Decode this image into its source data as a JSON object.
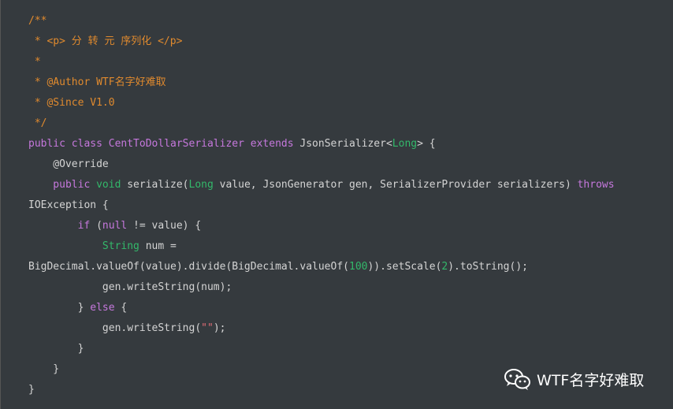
{
  "code": {
    "lines": [
      [
        {
          "t": "/**",
          "c": "cm"
        }
      ],
      [
        {
          "t": " * <p> 分 转 元 序列化 </p>",
          "c": "cm"
        }
      ],
      [
        {
          "t": " *",
          "c": "cm"
        }
      ],
      [
        {
          "t": " * @Author WTF名字好难取",
          "c": "cm"
        }
      ],
      [
        {
          "t": " * @Since V1.0",
          "c": "cm"
        }
      ],
      [
        {
          "t": " */",
          "c": "cm"
        }
      ],
      [
        {
          "t": "public class ",
          "c": "kw"
        },
        {
          "t": "CentToDollarSerializer",
          "c": "cls"
        },
        {
          "t": " extends ",
          "c": "kw"
        },
        {
          "t": "JsonSerializer<",
          "c": "pl"
        },
        {
          "t": "Long",
          "c": "ty"
        },
        {
          "t": "> {",
          "c": "pl"
        }
      ],
      [
        {
          "t": "    @Override",
          "c": "pl"
        }
      ],
      [
        {
          "t": "    public ",
          "c": "kw"
        },
        {
          "t": "void ",
          "c": "ty"
        },
        {
          "t": "serialize(",
          "c": "pl"
        },
        {
          "t": "Long",
          "c": "ty"
        },
        {
          "t": " value, JsonGenerator gen, SerializerProvider serializers) ",
          "c": "pl"
        },
        {
          "t": "throws",
          "c": "kw"
        }
      ],
      [
        {
          "t": "IOException {",
          "c": "pl"
        }
      ],
      [
        {
          "t": "        if ",
          "c": "kw"
        },
        {
          "t": "(",
          "c": "pl"
        },
        {
          "t": "null",
          "c": "kw"
        },
        {
          "t": " != value) {",
          "c": "pl"
        }
      ],
      [
        {
          "t": "            ",
          "c": "pl"
        },
        {
          "t": "String",
          "c": "ty"
        },
        {
          "t": " num =",
          "c": "pl"
        }
      ],
      [
        {
          "t": "BigDecimal.valueOf(value).divide(BigDecimal.valueOf(",
          "c": "pl"
        },
        {
          "t": "100",
          "c": "num"
        },
        {
          "t": ")).setScale(",
          "c": "pl"
        },
        {
          "t": "2",
          "c": "num"
        },
        {
          "t": ").toString();",
          "c": "pl"
        }
      ],
      [
        {
          "t": "            gen.writeString(num);",
          "c": "pl"
        }
      ],
      [
        {
          "t": "        } ",
          "c": "pl"
        },
        {
          "t": "else",
          "c": "kw"
        },
        {
          "t": " {",
          "c": "pl"
        }
      ],
      [
        {
          "t": "            gen.writeString(",
          "c": "pl"
        },
        {
          "t": "\"\"",
          "c": "str"
        },
        {
          "t": ");",
          "c": "pl"
        }
      ],
      [
        {
          "t": "        }",
          "c": "pl"
        }
      ],
      [
        {
          "t": "    }",
          "c": "pl"
        }
      ],
      [
        {
          "t": "}",
          "c": "pl"
        }
      ]
    ]
  },
  "watermark": {
    "icon": "wechat-icon",
    "text": "WTF名字好难取"
  }
}
